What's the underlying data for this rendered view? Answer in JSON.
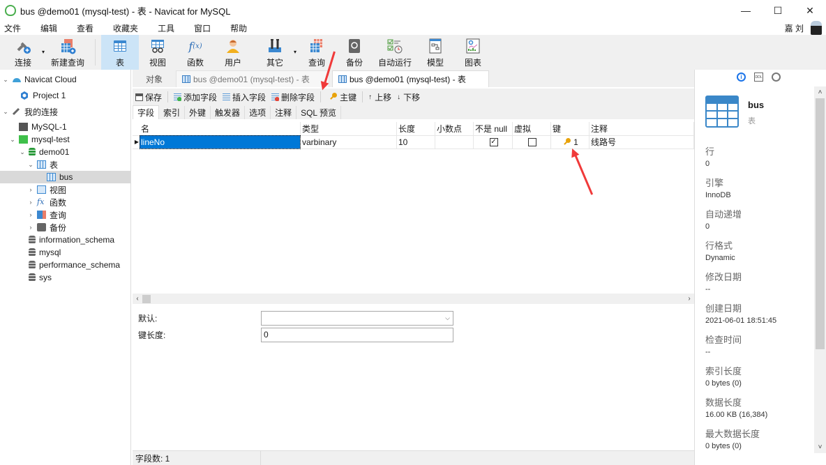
{
  "window": {
    "title": "bus @demo01 (mysql-test) - 表 - Navicat for MySQL",
    "minimize": "—",
    "maximize": "☐",
    "close": "✕"
  },
  "menu": {
    "items": [
      "文件",
      "编辑",
      "查看",
      "收藏夹",
      "工具",
      "窗口",
      "帮助"
    ],
    "user_name": "嘉 刘"
  },
  "toolbar": {
    "items": [
      {
        "label": "连接",
        "icon": "connect-icon"
      },
      {
        "label": "新建查询",
        "icon": "new-query-icon"
      },
      {
        "label": "表",
        "icon": "table-icon",
        "active": true
      },
      {
        "label": "视图",
        "icon": "view-icon"
      },
      {
        "label": "函数",
        "icon": "function-icon"
      },
      {
        "label": "用户",
        "icon": "user-icon"
      },
      {
        "label": "其它",
        "icon": "tools-icon"
      },
      {
        "label": "查询",
        "icon": "query-icon"
      },
      {
        "label": "备份",
        "icon": "backup-icon"
      },
      {
        "label": "自动运行",
        "icon": "schedule-icon"
      },
      {
        "label": "模型",
        "icon": "model-icon"
      },
      {
        "label": "图表",
        "icon": "chart-icon"
      }
    ]
  },
  "nav": {
    "items": [
      {
        "label": "Navicat Cloud",
        "level": 0,
        "expanded": true,
        "icon": "cloud-icon"
      },
      {
        "label": "Project 1",
        "level": 1,
        "icon": "project-icon"
      },
      {
        "label": "我的连接",
        "level": 0,
        "expanded": true,
        "icon": "connection-group-icon"
      },
      {
        "label": "MySQL-1",
        "level": 1,
        "icon": "mysql-connection-icon"
      },
      {
        "label": "mysql-test",
        "level": 1,
        "expanded": true,
        "icon": "mysql-connection-active-icon"
      },
      {
        "label": "demo01",
        "level": 2,
        "expanded": true,
        "icon": "database-active-icon"
      },
      {
        "label": "表",
        "level": 3,
        "expanded": true,
        "icon": "table-folder-icon"
      },
      {
        "label": "bus",
        "level": 4,
        "selected": true,
        "icon": "table-icon"
      },
      {
        "label": "视图",
        "level": 3,
        "collapsed": true,
        "icon": "view-folder-icon"
      },
      {
        "label": "函数",
        "level": 3,
        "collapsed": true,
        "icon": "function-folder-icon"
      },
      {
        "label": "查询",
        "level": 3,
        "collapsed": true,
        "icon": "query-folder-icon"
      },
      {
        "label": "备份",
        "level": 3,
        "collapsed": true,
        "icon": "backup-folder-icon"
      },
      {
        "label": "information_schema",
        "level": 2,
        "icon": "database-icon"
      },
      {
        "label": "mysql",
        "level": 2,
        "icon": "database-icon"
      },
      {
        "label": "performance_schema",
        "level": 2,
        "icon": "database-icon"
      },
      {
        "label": "sys",
        "level": 2,
        "icon": "database-icon"
      }
    ]
  },
  "tabs": {
    "objects": "对象",
    "tab1": "bus @demo01 (mysql-test) - 表",
    "tab2": "bus @demo01 (mysql-test) - 表"
  },
  "editor_toolbar": {
    "save": "保存",
    "add_field": "添加字段",
    "insert_field": "插入字段",
    "delete_field": "删除字段",
    "primary_key": "主键",
    "move_up": "上移",
    "move_down": "下移"
  },
  "subtabs": [
    "字段",
    "索引",
    "外键",
    "触发器",
    "选项",
    "注释",
    "SQL 预览"
  ],
  "grid": {
    "columns": [
      "名",
      "类型",
      "长度",
      "小数点",
      "不是 null",
      "虚拟",
      "键",
      "注释"
    ],
    "rows": [
      {
        "name": "lineNo",
        "type": "varbinary",
        "length": "10",
        "decimals": "",
        "not_null": true,
        "virtual": false,
        "key": "1",
        "comment": "线路号"
      }
    ]
  },
  "properties": {
    "default_label": "默认:",
    "default_value": "",
    "key_length_label": "键长度:",
    "key_length_value": "0"
  },
  "status": {
    "field_count": "字段数: 1"
  },
  "info_panel": {
    "object_name": "bus",
    "object_type": "表",
    "fields": [
      {
        "key": "行",
        "value": "0"
      },
      {
        "key": "引擎",
        "value": "InnoDB"
      },
      {
        "key": "自动递增",
        "value": "0"
      },
      {
        "key": "行格式",
        "value": "Dynamic"
      },
      {
        "key": "修改日期",
        "value": "--"
      },
      {
        "key": "创建日期",
        "value": "2021-06-01 18:51:45"
      },
      {
        "key": "检查时间",
        "value": "--"
      },
      {
        "key": "索引长度",
        "value": "0 bytes (0)"
      },
      {
        "key": "数据长度",
        "value": "16.00 KB (16,384)"
      },
      {
        "key": "最大数据长度",
        "value": "0 bytes (0)"
      }
    ]
  }
}
